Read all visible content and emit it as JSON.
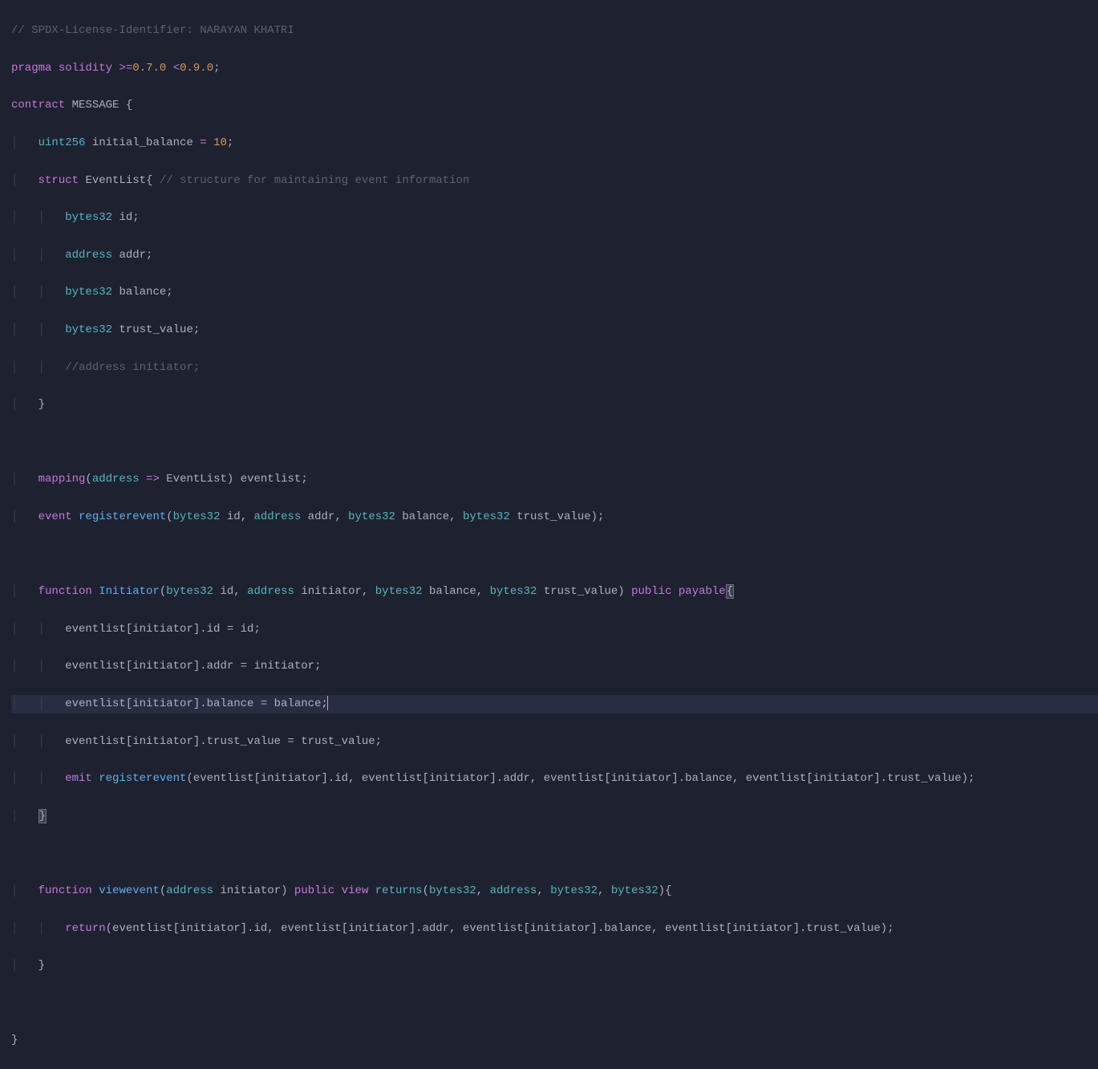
{
  "code": {
    "l1_comment": "// SPDX-License-Identifier: NARAYAN KHATRI",
    "l2_pragma": "pragma",
    "l2_solidity": "solidity",
    "l2_version": ">=0.7.0 <0.9.0",
    "l3_contract": "contract",
    "l3_name": "MESSAGE",
    "l4_type": "uint256",
    "l4_var": "initial_balance",
    "l4_val": "10",
    "l5_struct": "struct",
    "l5_name": "EventList",
    "l5_comment": "// structure for maintaining event information",
    "l6_type": "bytes32",
    "l6_var": "id",
    "l7_type": "address",
    "l7_var": "addr",
    "l8_type": "bytes32",
    "l8_var": "balance",
    "l9_type": "bytes32",
    "l9_var": "trust_value",
    "l10_comment": "//address initiator;",
    "l13_mapping": "mapping",
    "l13_addr": "address",
    "l13_eventlist": "EventList",
    "l13_var": "eventlist",
    "l14_event": "event",
    "l14_name": "registerevent",
    "l14_p1t": "bytes32",
    "l14_p1n": "id",
    "l14_p2t": "address",
    "l14_p2n": "addr",
    "l14_p3t": "bytes32",
    "l14_p3n": "balance",
    "l14_p4t": "bytes32",
    "l14_p4n": "trust_value",
    "l16_function": "function",
    "l16_name": "Initiator",
    "l16_p1t": "bytes32",
    "l16_p1n": "id",
    "l16_p2t": "address",
    "l16_p2n": "initiator",
    "l16_p3t": "bytes32",
    "l16_p3n": "balance",
    "l16_p4t": "bytes32",
    "l16_p4n": "trust_value",
    "l16_public": "public",
    "l16_payable": "payable",
    "l17": "eventlist[initiator].id = id;",
    "l18": "eventlist[initiator].addr = initiator;",
    "l19": "eventlist[initiator].balance = balance;",
    "l20": "eventlist[initiator].trust_value = trust_value;",
    "l21_emit": "emit",
    "l21_fn": "registerevent",
    "l21_args": "(eventlist[initiator].id, eventlist[initiator].addr, eventlist[initiator].balance, eventlist[initiator].trust_value);",
    "l24_function": "function",
    "l24_name": "viewevent",
    "l24_p1t": "address",
    "l24_p1n": "initiator",
    "l24_public": "public",
    "l24_view": "view",
    "l24_returns": "returns",
    "l24_r1": "bytes32",
    "l24_r2": "address",
    "l24_r3": "bytes32",
    "l24_r4": "bytes32",
    "l25_return": "return",
    "l25_args": "(eventlist[initiator].id, eventlist[initiator].addr, eventlist[initiator].balance, eventlist[initiator].trust_value);"
  }
}
